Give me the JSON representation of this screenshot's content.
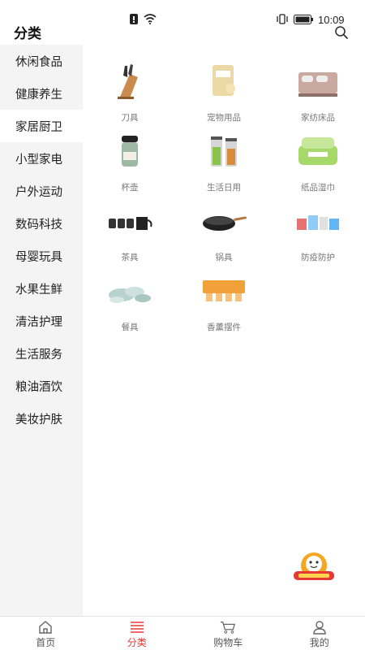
{
  "status_bar": {
    "time": "10:09"
  },
  "header": {
    "title": "分类"
  },
  "sidebar": {
    "items": [
      {
        "label": "休闲食品"
      },
      {
        "label": "健康养生"
      },
      {
        "label": "家居厨卫"
      },
      {
        "label": "小型家电"
      },
      {
        "label": "户外运动"
      },
      {
        "label": "数码科技"
      },
      {
        "label": "母婴玩具"
      },
      {
        "label": "水果生鲜"
      },
      {
        "label": "清洁护理"
      },
      {
        "label": "生活服务"
      },
      {
        "label": "粮油酒饮"
      },
      {
        "label": "美妆护肤"
      }
    ],
    "active": "家居厨卫"
  },
  "categories": [
    {
      "label": "刀具",
      "icon": "knife-block-icon"
    },
    {
      "label": "宠物用品",
      "icon": "pet-supplies-icon"
    },
    {
      "label": "家纺床品",
      "icon": "bedding-icon"
    },
    {
      "label": "杯壶",
      "icon": "thermos-cup-icon"
    },
    {
      "label": "生活日用",
      "icon": "storage-jars-icon"
    },
    {
      "label": "纸品湿巾",
      "icon": "tissue-pack-icon"
    },
    {
      "label": "茶具",
      "icon": "tea-set-icon"
    },
    {
      "label": "锅具",
      "icon": "wok-icon"
    },
    {
      "label": "防疫防护",
      "icon": "protective-supplies-icon"
    },
    {
      "label": "餐具",
      "icon": "tableware-icon"
    },
    {
      "label": "香薰摆件",
      "icon": "aroma-decor-icon"
    }
  ],
  "tabbar": {
    "items": [
      {
        "label": "首页"
      },
      {
        "label": "分类"
      },
      {
        "label": "购物车"
      },
      {
        "label": "我的"
      }
    ],
    "active": "分类"
  },
  "colors": {
    "accent": "#e53935",
    "sidebar_bg": "#f4f4f4"
  }
}
